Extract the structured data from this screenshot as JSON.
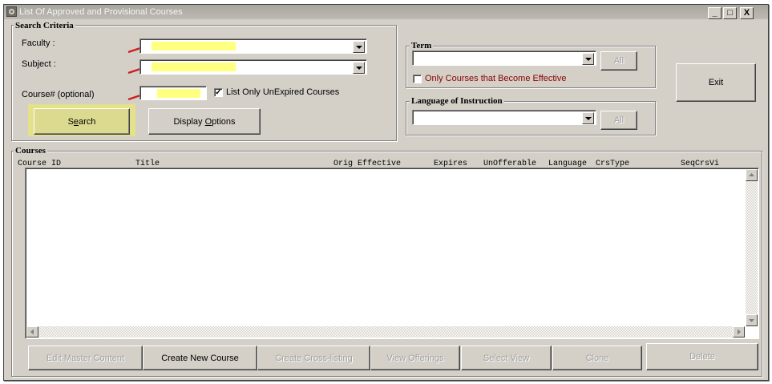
{
  "window": {
    "title": "List Of Approved and Provisional Courses",
    "controls": {
      "minimize": "_",
      "maximize": "□",
      "close": "X"
    }
  },
  "search_criteria": {
    "legend": "Search Criteria",
    "faculty_label": "Faculty :",
    "subject_label": "Subject :",
    "course_label": "Course# (optional)",
    "faculty_value": "",
    "subject_value": "",
    "course_value": "",
    "list_unexpired_label": "List Only UnExpired Courses",
    "list_unexpired_checked": true,
    "check_mark": "✓",
    "search_button": "Search",
    "search_mnemonic": "e",
    "display_options_button": "Display Options",
    "display_options_mnemonic": "O"
  },
  "term": {
    "legend": "Term",
    "value": "",
    "all_button": "All",
    "effective_label": "Only Courses that Become Effective",
    "effective_checked": false
  },
  "language": {
    "legend": "Language of Instruction",
    "value": "",
    "all_button": "All"
  },
  "exit_button": "Exit",
  "courses": {
    "legend": "Courses",
    "columns": [
      "Course ID",
      "Title",
      "Orig Effective",
      "Expires",
      "UnOfferable",
      "Language",
      "CrsType",
      "SeqCrsVi"
    ],
    "rows": []
  },
  "bottom_buttons": {
    "edit_master": "Edit Master Content",
    "create_new": "Create New Course",
    "create_cross": "Create Cross-listing",
    "view_offerings": "View Offerings",
    "select_view": "Select View",
    "clone": "Clone",
    "delete": "Delete"
  },
  "colors": {
    "window_face": "#d4d0c8",
    "highlight_yellow": "#ffff80",
    "annotation_red": "#cc1f1f",
    "effective_text": "#8b0000"
  }
}
